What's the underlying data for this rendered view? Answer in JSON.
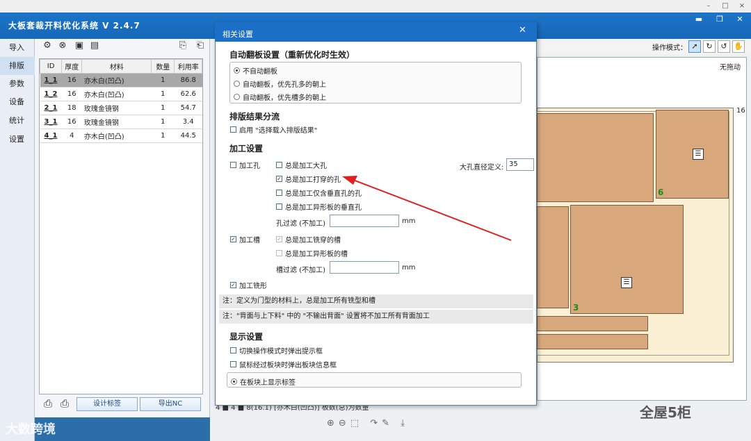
{
  "app": {
    "title": "大板套裁开料优化系统 V 2.4.7"
  },
  "window_controls": {
    "min": "–",
    "max": "□",
    "close": "×"
  },
  "nav": {
    "items": [
      "导入",
      "排版",
      "参数",
      "设备",
      "统计",
      "设置"
    ],
    "active": "排版"
  },
  "parts_table": {
    "headers": [
      "ID",
      "厚度",
      "材料",
      "数量",
      "利用率"
    ],
    "rows": [
      {
        "id": "1_1",
        "thickness": "16",
        "material": "亦木白(凹凸)",
        "qty": "1",
        "rate": "86.8",
        "selected": true
      },
      {
        "id": "1_2",
        "thickness": "16",
        "material": "亦木白(凹凸)",
        "qty": "1",
        "rate": "62.6"
      },
      {
        "id": "2_1",
        "thickness": "18",
        "material": "玫瑰金镜钢",
        "qty": "1",
        "rate": "54.7"
      },
      {
        "id": "3_1",
        "thickness": "16",
        "material": "玫瑰金镜钢",
        "qty": "1",
        "rate": "3.4"
      },
      {
        "id": "4_1",
        "thickness": "4",
        "material": "亦木白(凹凸)",
        "qty": "1",
        "rate": "44.5"
      }
    ]
  },
  "left_buttons": {
    "design_label": "设计标签",
    "export_nc": "导出NC"
  },
  "toolbar": {
    "mode_label": "操作模式："
  },
  "canvas": {
    "no_drag": "无拖动",
    "board_thickness": "16",
    "panel_labels": [
      "6",
      "3"
    ]
  },
  "status_text": "4 ■ 4 ■ 8(16.1)   [亦木白(凹凸)] 板数(总)为数量",
  "dialog": {
    "title": "相关设置",
    "auto_flip": {
      "heading": "自动翻板设置（重新优化时生效）",
      "options": [
        "不自动翻板",
        "自动翻板，优先孔多的朝上",
        "自动翻板，优先槽多的朝上"
      ],
      "selected": 0
    },
    "result_split": {
      "heading": "排版结果分流",
      "enable_label": "启用 \"选择载入排版结果\""
    },
    "processing": {
      "heading": "加工设置",
      "hole_label": "加工孔",
      "hole_checked": false,
      "hole_options": [
        {
          "label": "总是加工大孔",
          "checked": false
        },
        {
          "label": "总是加工打穿的孔",
          "checked": true
        },
        {
          "label": "总是加工仅含垂直孔的孔",
          "checked": false
        },
        {
          "label": "总是加工异形板的垂直孔",
          "checked": false
        }
      ],
      "big_hole_label": "大孔直径定义:",
      "big_hole_value": "35",
      "hole_filter_label": "孔过滤 (不加工)",
      "hole_filter_value": "",
      "unit": "mm",
      "groove_label": "加工槽",
      "groove_checked": true,
      "groove_options": [
        {
          "label": "总是加工铣穿的槽",
          "checked": true
        },
        {
          "label": "总是加工异形板的槽",
          "checked": false
        }
      ],
      "groove_filter_label": "槽过滤 (不加工)",
      "groove_filter_value": "",
      "milling_label": "加工铣形",
      "milling_checked": true
    },
    "notes": [
      "注：定义为门型的材料上，总是加工所有铣型和槽",
      "注：\"背面与上下料\" 中的 \"不输出背面\" 设置将不加工所有背面加工"
    ],
    "display": {
      "heading": "显示设置",
      "options": [
        "切换操作模式时弹出提示框",
        "鼠标经过板块时弹出板块信息框"
      ],
      "label_option": "在板块上显示标签"
    }
  },
  "watermarks": {
    "left": "大数跨境",
    "right": "全屋5柜"
  },
  "colors": {
    "titlebar": "#1c6fc7",
    "panel": "#d8a87c",
    "arrow": "#e02020",
    "board": "#fbefd4"
  }
}
